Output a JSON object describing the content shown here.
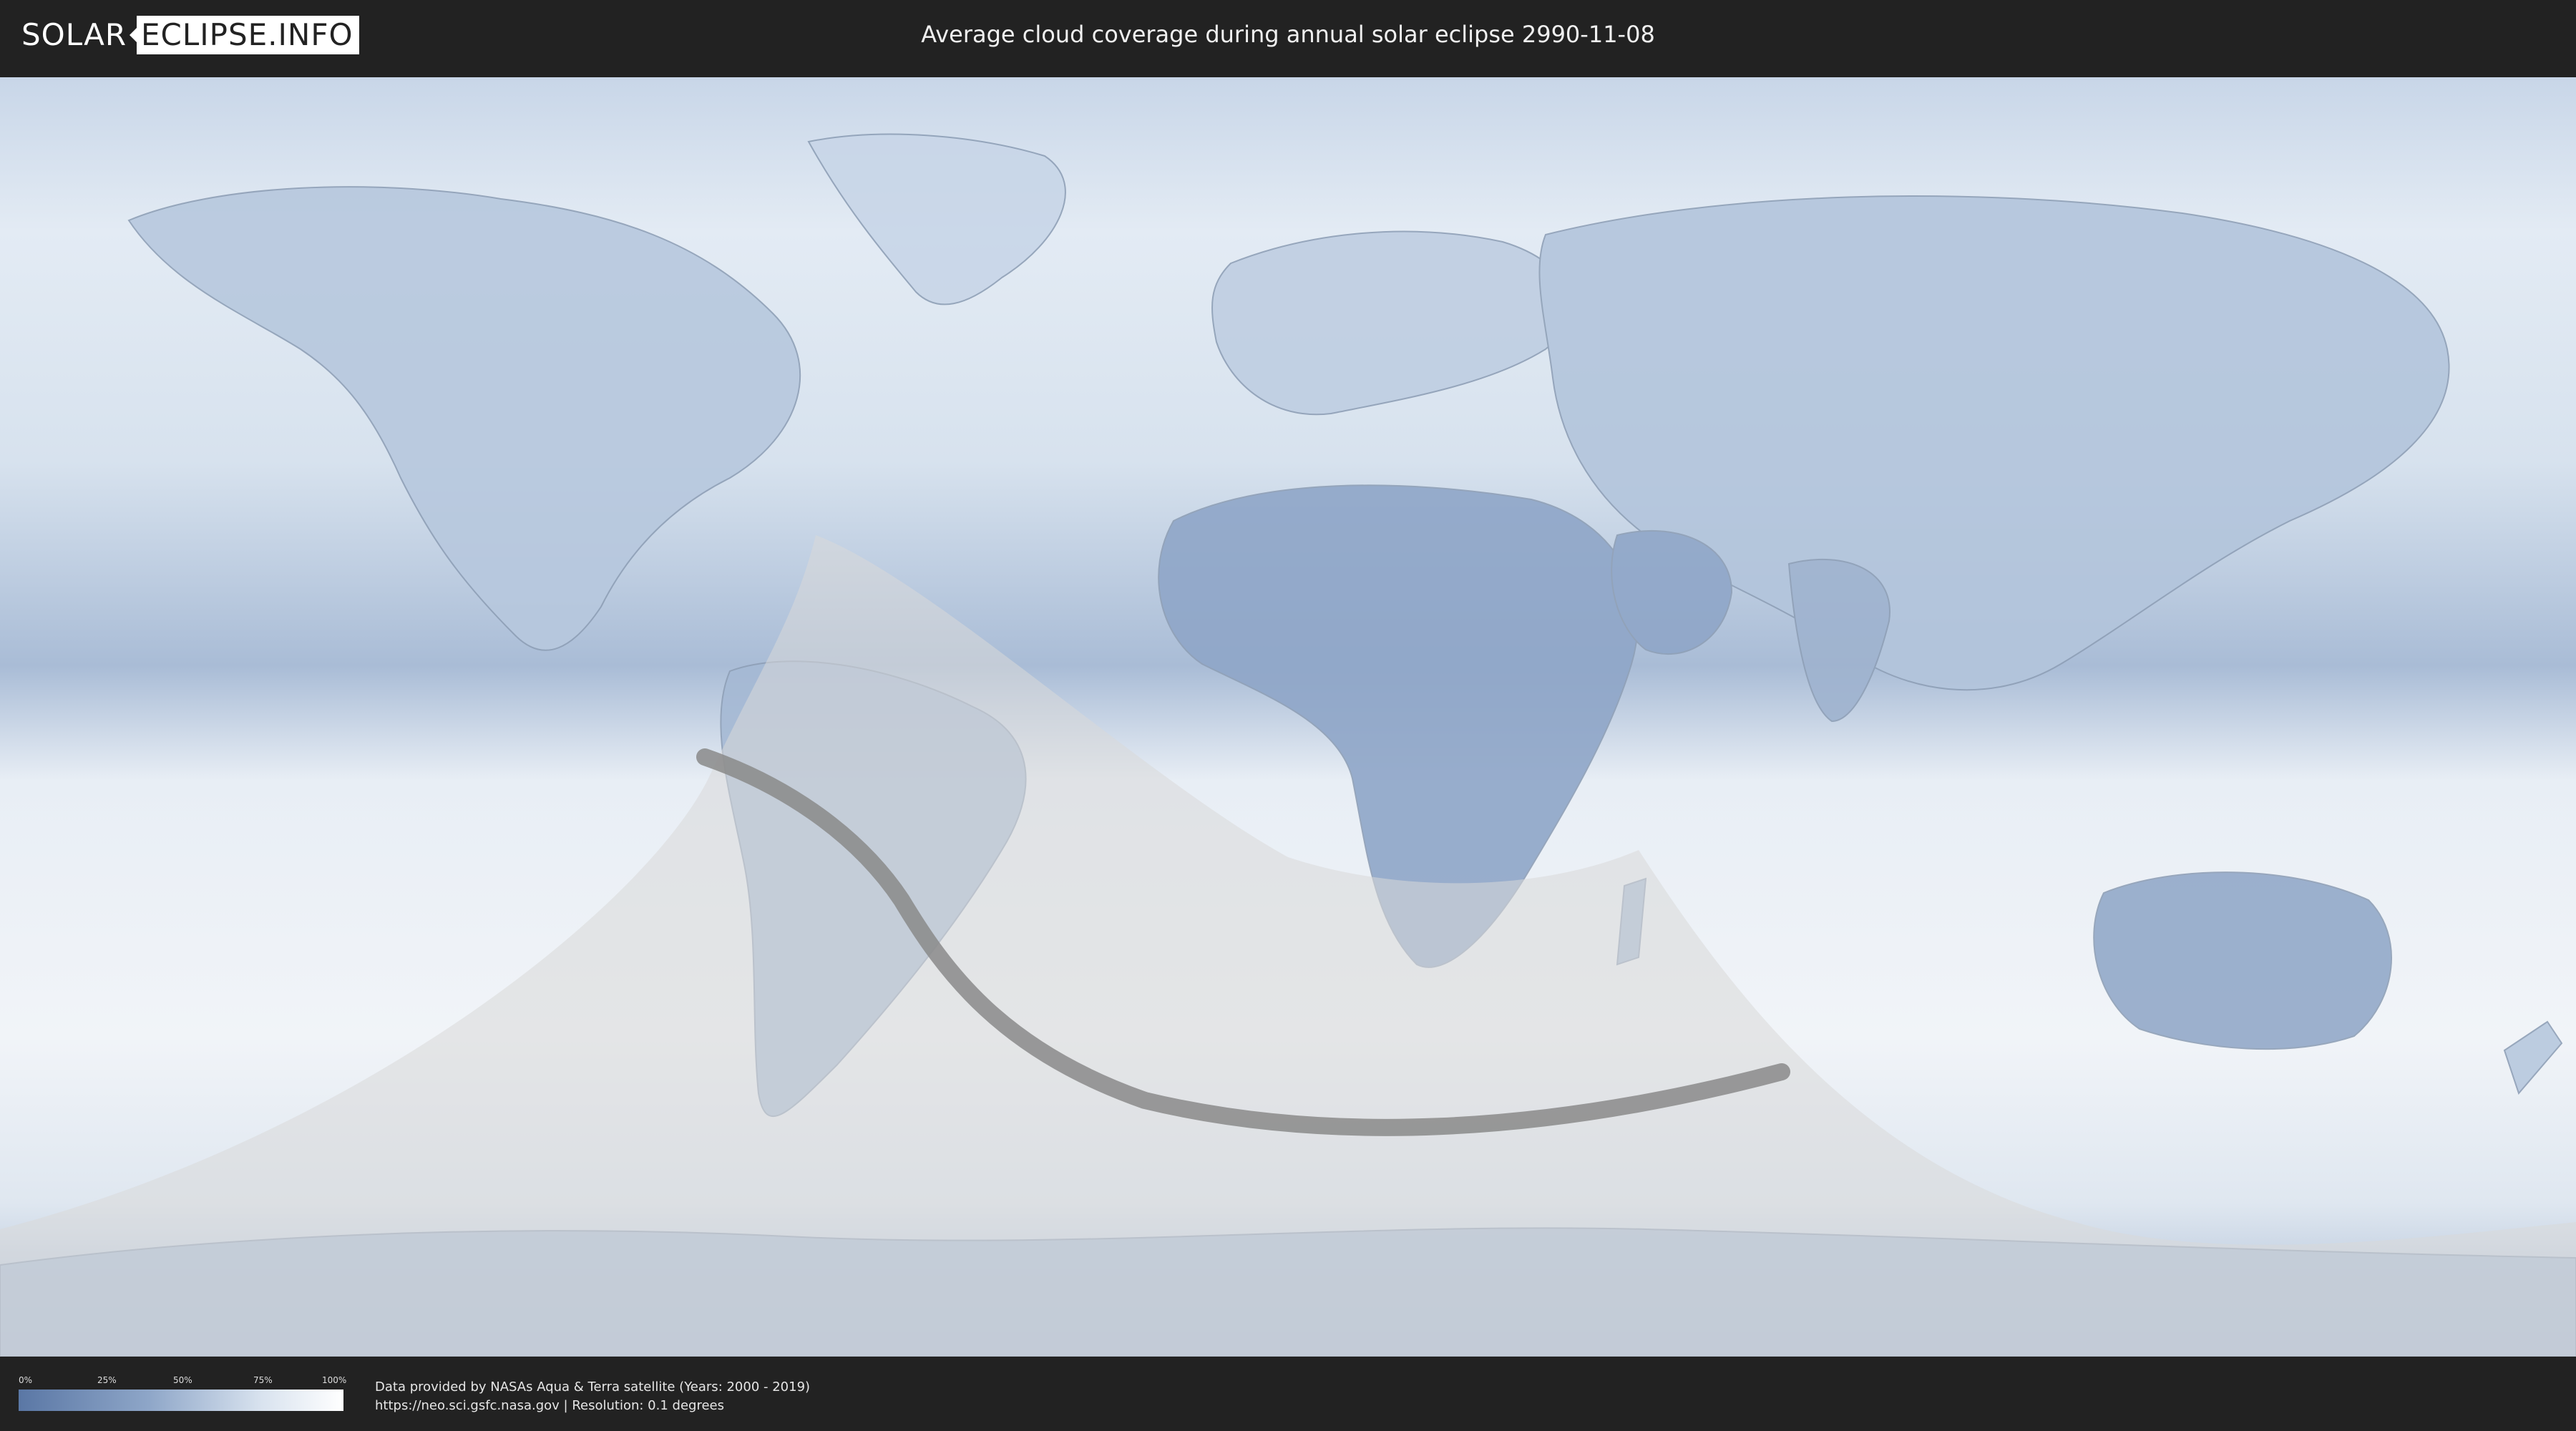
{
  "header": {
    "logo_part1": "SOLAR",
    "logo_part2": "ECLIPSE.INFO",
    "title": "Average cloud coverage during annual solar eclipse 2990-11-08"
  },
  "legend": {
    "ticks": [
      "0%",
      "25%",
      "50%",
      "75%",
      "100%"
    ],
    "gradient_colors": [
      "#5a77a5",
      "#8ea6c8",
      "#d9e3ef",
      "#ffffff"
    ]
  },
  "credits": {
    "line1": "Data provided by NASAs Aqua & Terra satellite (Years: 2000 - 2019)",
    "line2": "https://neo.sci.gsfc.nasa.gov | Resolution: 0.1 degrees"
  },
  "colors": {
    "background": "#222222",
    "clear_sky": "#5a77a5",
    "cloud": "#ffffff",
    "eclipse_penumbra": "#d8d8d8",
    "eclipse_central_path": "#8a8a8a"
  }
}
